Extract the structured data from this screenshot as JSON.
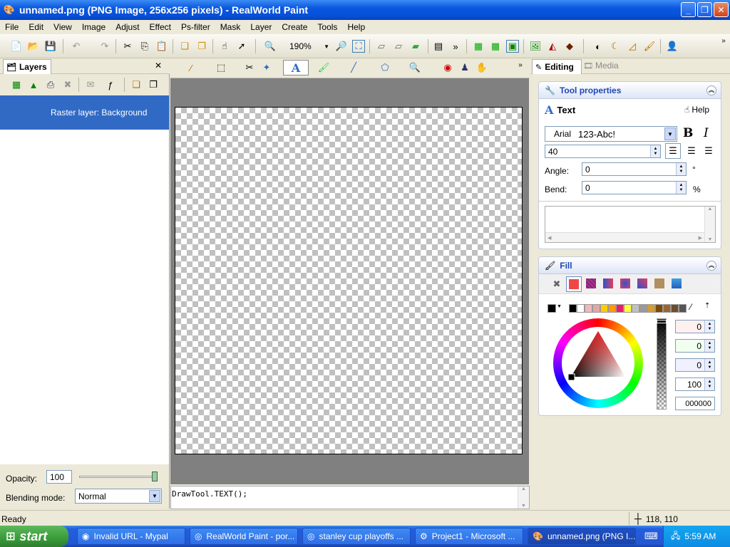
{
  "window": {
    "title": "unnamed.png (PNG Image, 256x256 pixels) - RealWorld Paint"
  },
  "menu": [
    "File",
    "Edit",
    "View",
    "Image",
    "Adjust",
    "Effect",
    "Ps-filter",
    "Mask",
    "Layer",
    "Create",
    "Tools",
    "Help"
  ],
  "toolbar": {
    "zoom": "190%"
  },
  "layers": {
    "tab_label": "Layers",
    "items": [
      "Raster layer: Background"
    ],
    "opacity_label": "Opacity:",
    "opacity_value": "100",
    "blending_label": "Blending mode:",
    "blending_value": "Normal"
  },
  "script_line": "DrawTool.TEXT();",
  "right_tabs": {
    "editing": "Editing",
    "media": "Media"
  },
  "tool_properties": {
    "header": "Tool properties",
    "tool_name": "Text",
    "help": "Help",
    "font_name": "Arial",
    "font_preview": "123-Abc!",
    "font_size": "40",
    "angle_label": "Angle:",
    "angle_value": "0",
    "angle_unit": "°",
    "bend_label": "Bend:",
    "bend_value": "0",
    "bend_unit": "%"
  },
  "fill": {
    "header": "Fill",
    "channels": [
      "0",
      "0",
      "0",
      "100"
    ],
    "hex": "000000",
    "palette": [
      "#000000",
      "#ffffff",
      "#f2b8b8",
      "#e8a4a4",
      "#ffcc00",
      "#ff9900",
      "#ec1c6c",
      "#ffff33",
      "#c0c0c0",
      "#999999",
      "#d89c2c",
      "#7a4a0a",
      "#996633",
      "#6b4e2e",
      "#555555"
    ]
  },
  "status": {
    "left": "Ready",
    "coords": "118, 110"
  },
  "taskbar": {
    "start": "start",
    "tasks": [
      "Invalid URL - Mypal",
      "RealWorld Paint - por...",
      "stanley cup playoffs ...",
      "Project1 - Microsoft ...",
      "unnamed.png (PNG I..."
    ],
    "time": "5:59 AM"
  },
  "colors": {
    "selection": "#316ac5",
    "accent": "#1f47b5"
  }
}
